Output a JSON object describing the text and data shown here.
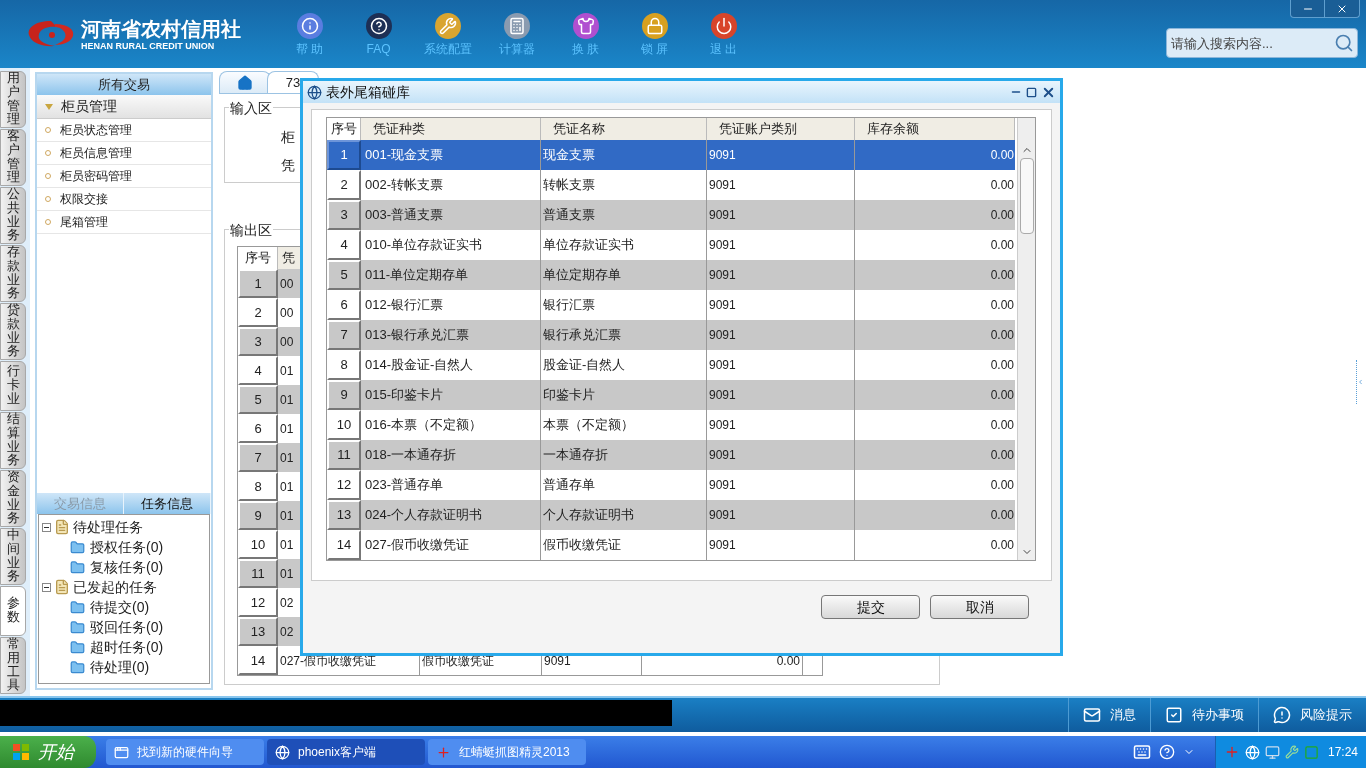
{
  "app": {
    "logo_title": "河南省农村信用社",
    "logo_subtitle": "HENAN RURAL CREDIT UNION"
  },
  "toolbar": [
    {
      "label": "帮 助",
      "kind": "info"
    },
    {
      "label": "FAQ",
      "kind": "faq"
    },
    {
      "label": "系统配置",
      "kind": "config"
    },
    {
      "label": "计算器",
      "kind": "calculator"
    },
    {
      "label": "换 肤",
      "kind": "skin"
    },
    {
      "label": "锁 屏",
      "kind": "lock"
    },
    {
      "label": "退 出",
      "kind": "exit"
    }
  ],
  "search": {
    "placeholder": "请输入搜索内容..."
  },
  "side_tabs": [
    {
      "label": "用户管理",
      "selected": false
    },
    {
      "label": "客户管理",
      "selected": false
    },
    {
      "label": "公共业务",
      "selected": false
    },
    {
      "label": "存款业务",
      "selected": false
    },
    {
      "label": "贷款业务",
      "selected": false
    },
    {
      "label": "行卡业",
      "selected": false
    },
    {
      "label": "结算业务",
      "selected": false
    },
    {
      "label": "资金业务",
      "selected": false
    },
    {
      "label": "中间业务",
      "selected": false
    },
    {
      "label": "参数",
      "selected": true
    },
    {
      "label": "常用工具",
      "selected": false
    }
  ],
  "sidebar": {
    "title": "所有交易",
    "group": {
      "label": "柜员管理",
      "expanded": true,
      "items": [
        "柜员状态管理",
        "柜员信息管理",
        "柜员密码管理",
        "权限交接",
        "尾箱管理"
      ]
    },
    "bottom_tabs": [
      {
        "label": "交易信息",
        "selected": false
      },
      {
        "label": "任务信息",
        "selected": true
      }
    ],
    "tree": [
      {
        "label": "待处理任务",
        "expanded": true,
        "children": [
          {
            "label": "授权任务(0)"
          },
          {
            "label": "复核任务(0)"
          }
        ]
      },
      {
        "label": "已发起的任务",
        "expanded": true,
        "children": [
          {
            "label": "待提交(0)"
          },
          {
            "label": "驳回任务(0)"
          },
          {
            "label": "超时任务(0)"
          },
          {
            "label": "待处理(0)"
          }
        ]
      }
    ]
  },
  "content": {
    "tabs": [
      {
        "kind": "home",
        "selected": false
      },
      {
        "kind": "text",
        "label": "73",
        "selected": true
      }
    ],
    "input_area": {
      "title": "输入区",
      "labels": [
        "柜",
        "凭"
      ]
    },
    "output_area": {
      "title": "输出区",
      "columns": [
        "序号",
        "凭"
      ],
      "rows": [
        {
          "cells": [
            "1",
            "00"
          ]
        },
        {
          "cells": [
            "2",
            "00"
          ]
        },
        {
          "cells": [
            "3",
            "00"
          ]
        },
        {
          "cells": [
            "4",
            "01"
          ]
        },
        {
          "cells": [
            "5",
            "01"
          ]
        },
        {
          "cells": [
            "6",
            "01"
          ]
        },
        {
          "cells": [
            "7",
            "01"
          ]
        },
        {
          "cells": [
            "8",
            "01"
          ]
        },
        {
          "cells": [
            "9",
            "01"
          ]
        },
        {
          "cells": [
            "10",
            "01"
          ]
        },
        {
          "cells": [
            "11",
            "01"
          ]
        },
        {
          "cells": [
            "12",
            "02"
          ]
        },
        {
          "cells": [
            "13",
            "02"
          ]
        },
        {
          "cells": [
            "14",
            "027-假币收缴凭证",
            "假币收缴凭证",
            "9091",
            "0.00"
          ]
        }
      ]
    }
  },
  "dialog": {
    "title": "表外尾箱碰库",
    "columns": [
      "序号",
      "凭证种类",
      "凭证名称",
      "凭证账户类别",
      "库存余额"
    ],
    "rows": [
      {
        "no": "1",
        "type": "001-现金支票",
        "name": "现金支票",
        "account": "9091",
        "balance": "0.00",
        "selected": true
      },
      {
        "no": "2",
        "type": "002-转帐支票",
        "name": "转帐支票",
        "account": "9091",
        "balance": "0.00",
        "selected": false
      },
      {
        "no": "3",
        "type": "003-普通支票",
        "name": "普通支票",
        "account": "9091",
        "balance": "0.00",
        "selected": false
      },
      {
        "no": "4",
        "type": "010-单位存款证实书",
        "name": "单位存款证实书",
        "account": "9091",
        "balance": "0.00",
        "selected": false
      },
      {
        "no": "5",
        "type": "011-单位定期存单",
        "name": "单位定期存单",
        "account": "9091",
        "balance": "0.00",
        "selected": false
      },
      {
        "no": "6",
        "type": "012-银行汇票",
        "name": "银行汇票",
        "account": "9091",
        "balance": "0.00",
        "selected": false
      },
      {
        "no": "7",
        "type": "013-银行承兑汇票",
        "name": "银行承兑汇票",
        "account": "9091",
        "balance": "0.00",
        "selected": false
      },
      {
        "no": "8",
        "type": "014-股金证-自然人",
        "name": "股金证-自然人",
        "account": "9091",
        "balance": "0.00",
        "selected": false
      },
      {
        "no": "9",
        "type": "015-印鉴卡片",
        "name": "印鉴卡片",
        "account": "9091",
        "balance": "0.00",
        "selected": false
      },
      {
        "no": "10",
        "type": "016-本票（不定额）",
        "name": "本票（不定额）",
        "account": "9091",
        "balance": "0.00",
        "selected": false
      },
      {
        "no": "11",
        "type": "018-一本通存折",
        "name": "一本通存折",
        "account": "9091",
        "balance": "0.00",
        "selected": false
      },
      {
        "no": "12",
        "type": "023-普通存单",
        "name": "普通存单",
        "account": "9091",
        "balance": "0.00",
        "selected": false
      },
      {
        "no": "13",
        "type": "024-个人存款证明书",
        "name": "个人存款证明书",
        "account": "9091",
        "balance": "0.00",
        "selected": false
      },
      {
        "no": "14",
        "type": "027-假币收缴凭证",
        "name": "假币收缴凭证",
        "account": "9091",
        "balance": "0.00",
        "selected": false
      }
    ],
    "buttons": [
      "提交",
      "取消"
    ]
  },
  "status_buttons": [
    {
      "label": "消息",
      "kind": "mail"
    },
    {
      "label": "待办事项",
      "kind": "todo"
    },
    {
      "label": "风险提示",
      "kind": "alert"
    }
  ],
  "taskbar": {
    "start": "开始",
    "tasks": [
      {
        "label": "找到新的硬件向导",
        "kind": "window",
        "selected": false
      },
      {
        "label": "phoenix客户端",
        "kind": "client",
        "selected": true
      },
      {
        "label": "红蜻蜓抓图精灵2013",
        "kind": "capture",
        "selected": false
      }
    ],
    "clock": "17:24"
  }
}
